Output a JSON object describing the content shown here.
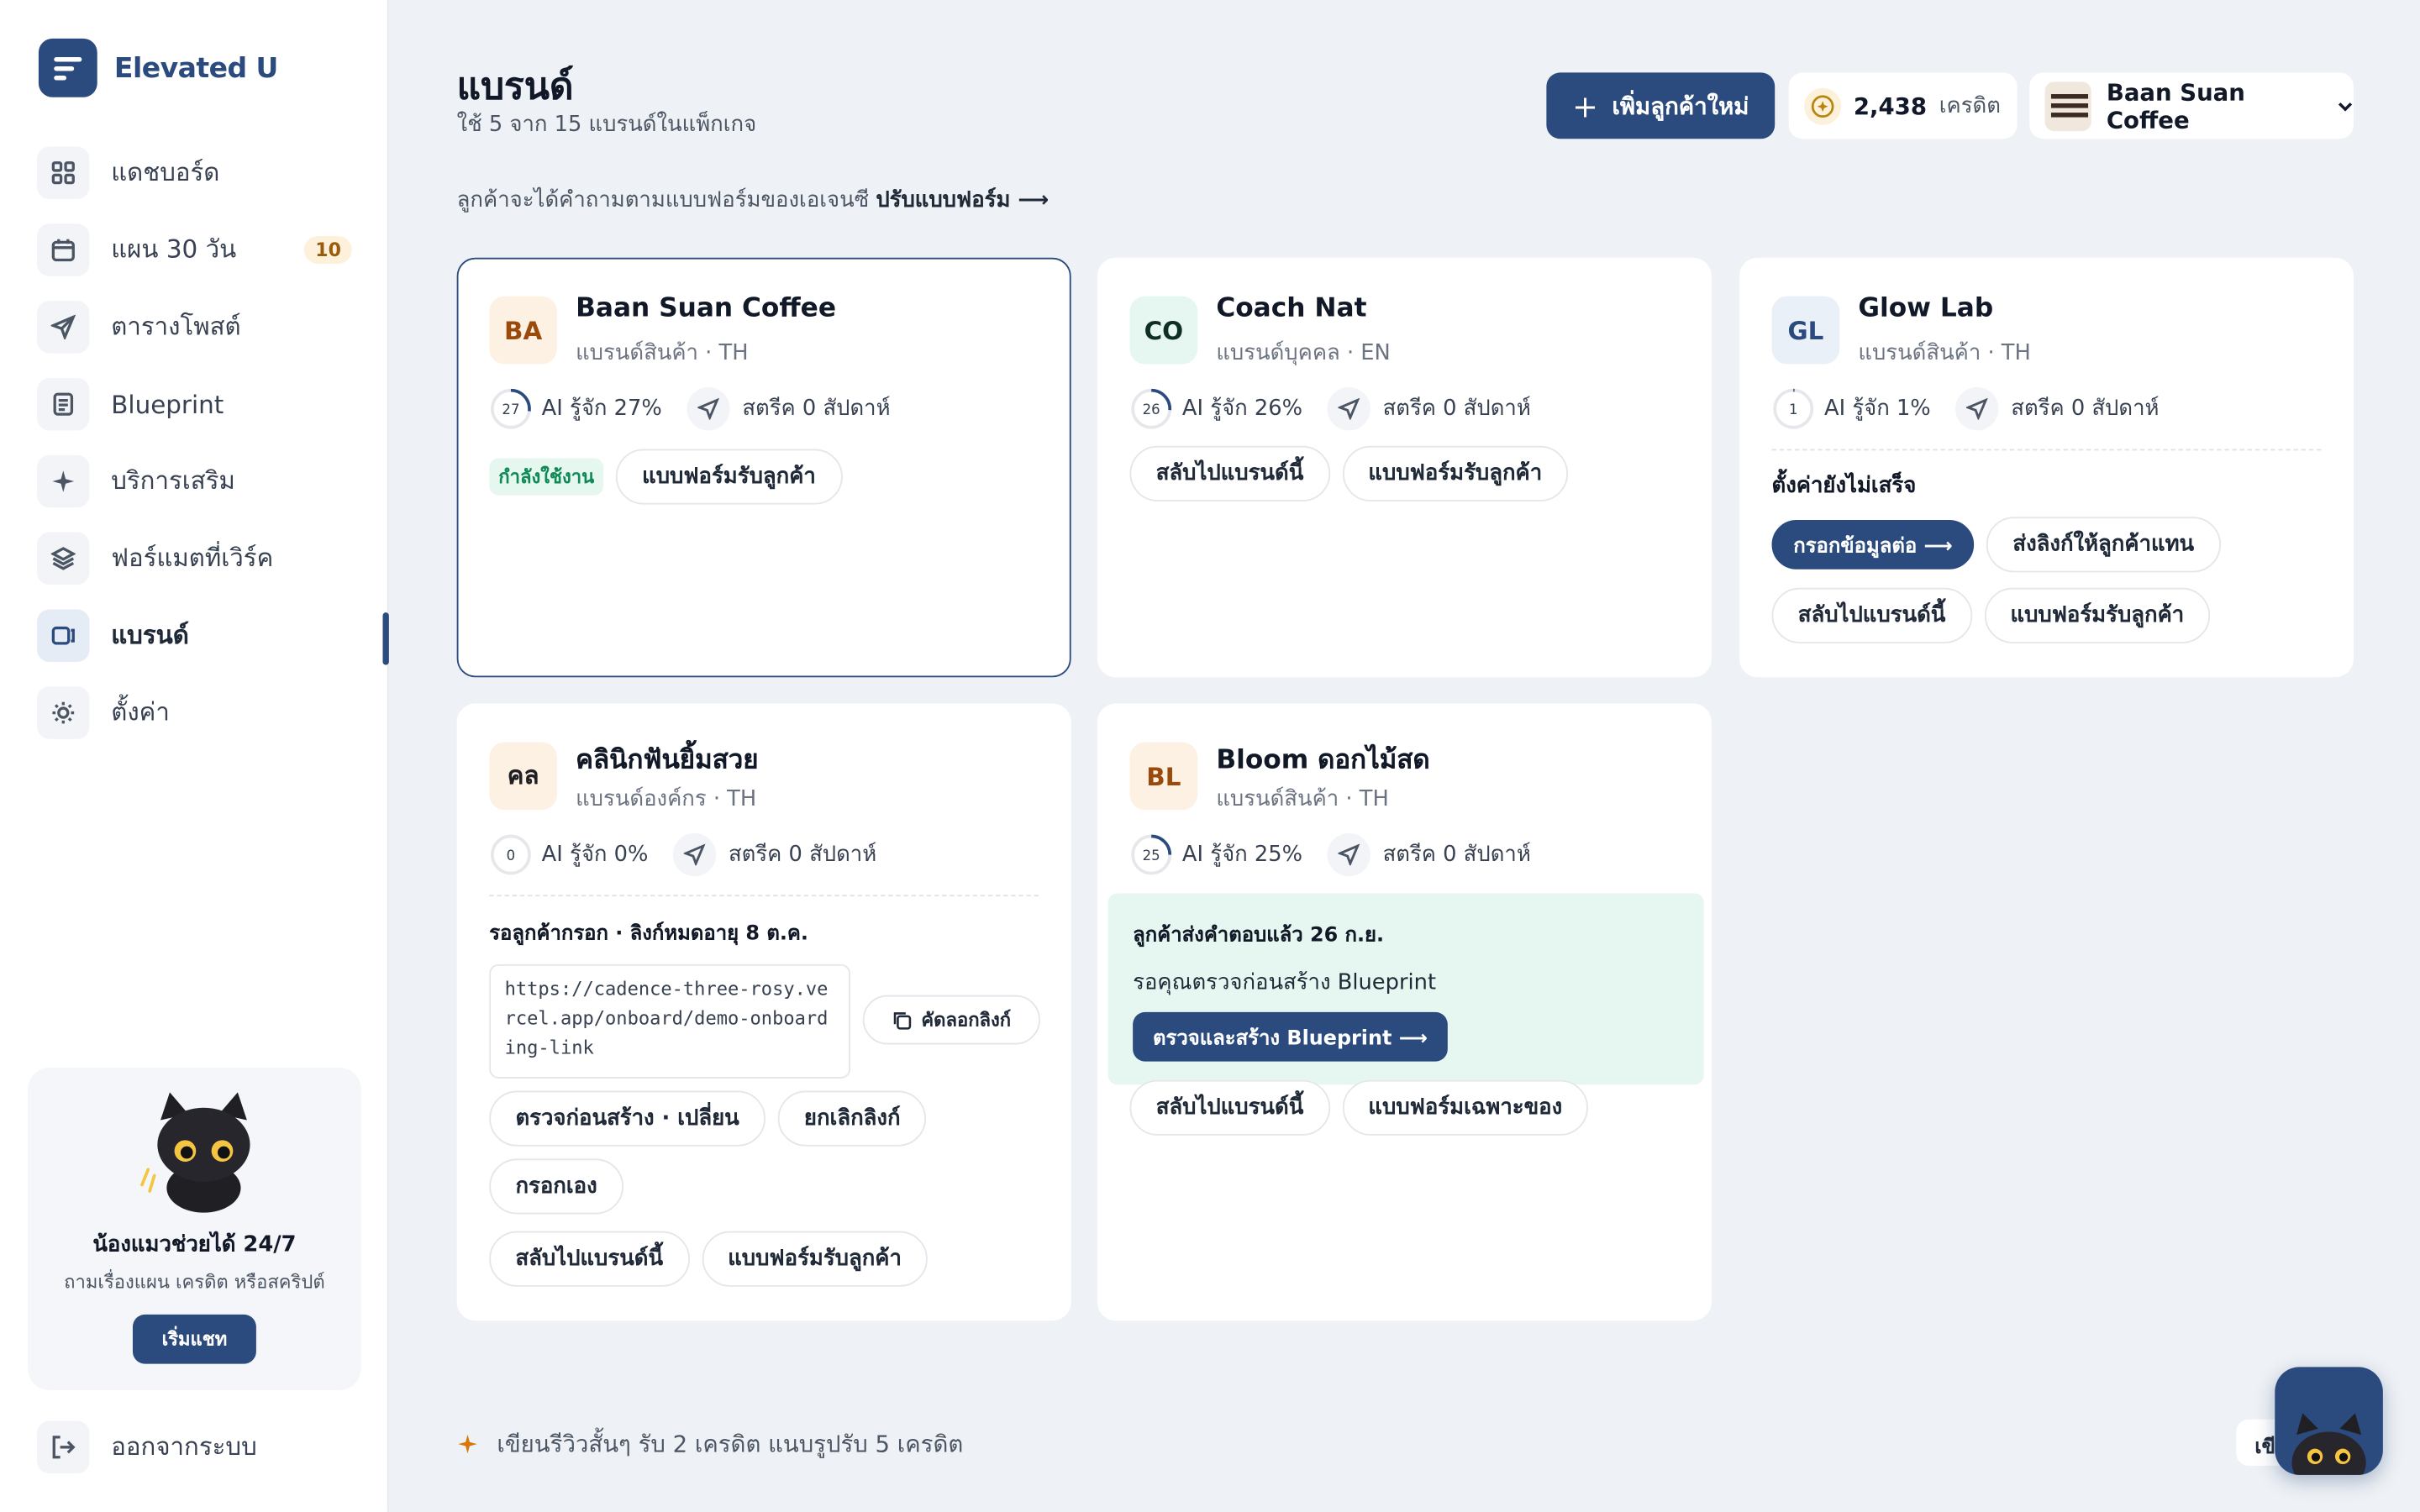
{
  "app": {
    "name": "Elevated U"
  },
  "sidebar": {
    "items": [
      {
        "label": "แดชบอร์ด",
        "icon": "grid-icon"
      },
      {
        "label": "แผน 30 วัน",
        "icon": "calendar-icon",
        "badge": "10"
      },
      {
        "label": "ตารางโพสต์",
        "icon": "send-icon"
      },
      {
        "label": "Blueprint",
        "icon": "document-icon"
      },
      {
        "label": "บริการเสริม",
        "icon": "sparkle-icon"
      },
      {
        "label": "ฟอร์แมตที่เวิร์ค",
        "icon": "layers-icon"
      },
      {
        "label": "แบรนด์",
        "icon": "brand-icon",
        "active": true
      },
      {
        "label": "ตั้งค่า",
        "icon": "sun-icon"
      }
    ],
    "chat": {
      "title": "น้องแมวช่วยได้ 24/7",
      "subtitle": "ถามเรื่องแผน เครดิต หรือสคริปต์",
      "button": "เริ่มแชท"
    },
    "logout": "ออกจากระบบ"
  },
  "header": {
    "title": "แบรนด์",
    "subtitle": "ใช้ 5 จาก 15 แบรนด์ในแพ็กเกจ",
    "hint": "ลูกค้าจะได้คำถามตามแบบฟอร์มของเอเจนซี",
    "hint_link": "ปรับแบบฟอร์ม ⟶",
    "add_button": "เพิ่มลูกค้าใหม่",
    "credits_value": "2,438",
    "credits_unit": "เครดิต",
    "current_brand": "Baan Suan Coffee"
  },
  "brands": [
    {
      "initials": "BA",
      "name": "Baan Suan Coffee",
      "meta": "แบรนด์สินค้า · TH",
      "ai_pct": 27,
      "ai_label": "AI รู้จัก 27%",
      "streak": "สตรีค 0 สัปดาห์",
      "status": "กำลังใช้งาน",
      "form_button": "แบบฟอร์มรับลูกค้า"
    },
    {
      "initials": "CO",
      "name": "Coach Nat",
      "meta": "แบรนด์บุคคล · EN",
      "ai_pct": 26,
      "ai_label": "AI รู้จัก 26%",
      "streak": "สตรีค 0 สัปดาห์",
      "switch_button": "สลับไปแบรนด์นี้",
      "form_button": "แบบฟอร์มรับลูกค้า"
    },
    {
      "initials": "GL",
      "name": "Glow Lab",
      "meta": "แบรนด์สินค้า · TH",
      "ai_pct": 1,
      "ai_label": "AI รู้จัก 1%",
      "streak": "สตรีค 0 สัปดาห์",
      "setup_title": "ตั้งค่ายังไม่เสร็จ",
      "continue_button": "กรอกข้อมูลต่อ ⟶",
      "send_link_button": "ส่งลิงก์ให้ลูกค้าแทน",
      "switch_button": "สลับไปแบรนด์นี้",
      "form_button": "แบบฟอร์มรับลูกค้า"
    },
    {
      "initials": "คล",
      "name": "คลินิกฟันยิ้มสวย",
      "meta": "แบรนด์องค์กร · TH",
      "ai_pct": 0,
      "ai_label": "AI รู้จัก 0%",
      "streak": "สตรีค 0 สัปดาห์",
      "waiting_title": "รอลูกค้ากรอก · ลิงก์หมดอายุ 8 ต.ค.",
      "link": "https://cadence-three-rosy.vercel.app/onboard/demo-onboarding-link",
      "copy_button": "คัดลอกลิงก์",
      "review_button": "ตรวจก่อนสร้าง · เปลี่ยน",
      "cancel_button": "ยกเลิกลิงก์",
      "self_fill_button": "กรอกเอง",
      "switch_button": "สลับไปแบรนด์นี้",
      "form_button": "แบบฟอร์มรับลูกค้า"
    },
    {
      "initials": "BL",
      "name": "Bloom ดอกไม้สด",
      "meta": "แบรนด์สินค้า · TH",
      "ai_pct": 25,
      "ai_label": "AI รู้จัก 25%",
      "streak": "สตรีค 0 สัปดาห์",
      "notice_title": "ลูกค้าส่งคำตอบแล้ว 26 ก.ย.",
      "notice_sub": "รอคุณตรวจก่อนสร้าง Blueprint",
      "notice_button": "ตรวจและสร้าง Blueprint ⟶",
      "switch_button": "สลับไปแบรนด์นี้",
      "form_button": "แบบฟอร์มเฉพาะของ"
    }
  ],
  "footer": {
    "note": "เขียนรีวิวสั้นๆ รับ 2 เครดิต แนบรูปรับ 5 เครดิต",
    "corner_label": "เขีย"
  },
  "colors": {
    "primary": "#2b4a7e",
    "page_bg": "#eef1f5",
    "accent": "#d97706",
    "success": "#0f8a55"
  }
}
